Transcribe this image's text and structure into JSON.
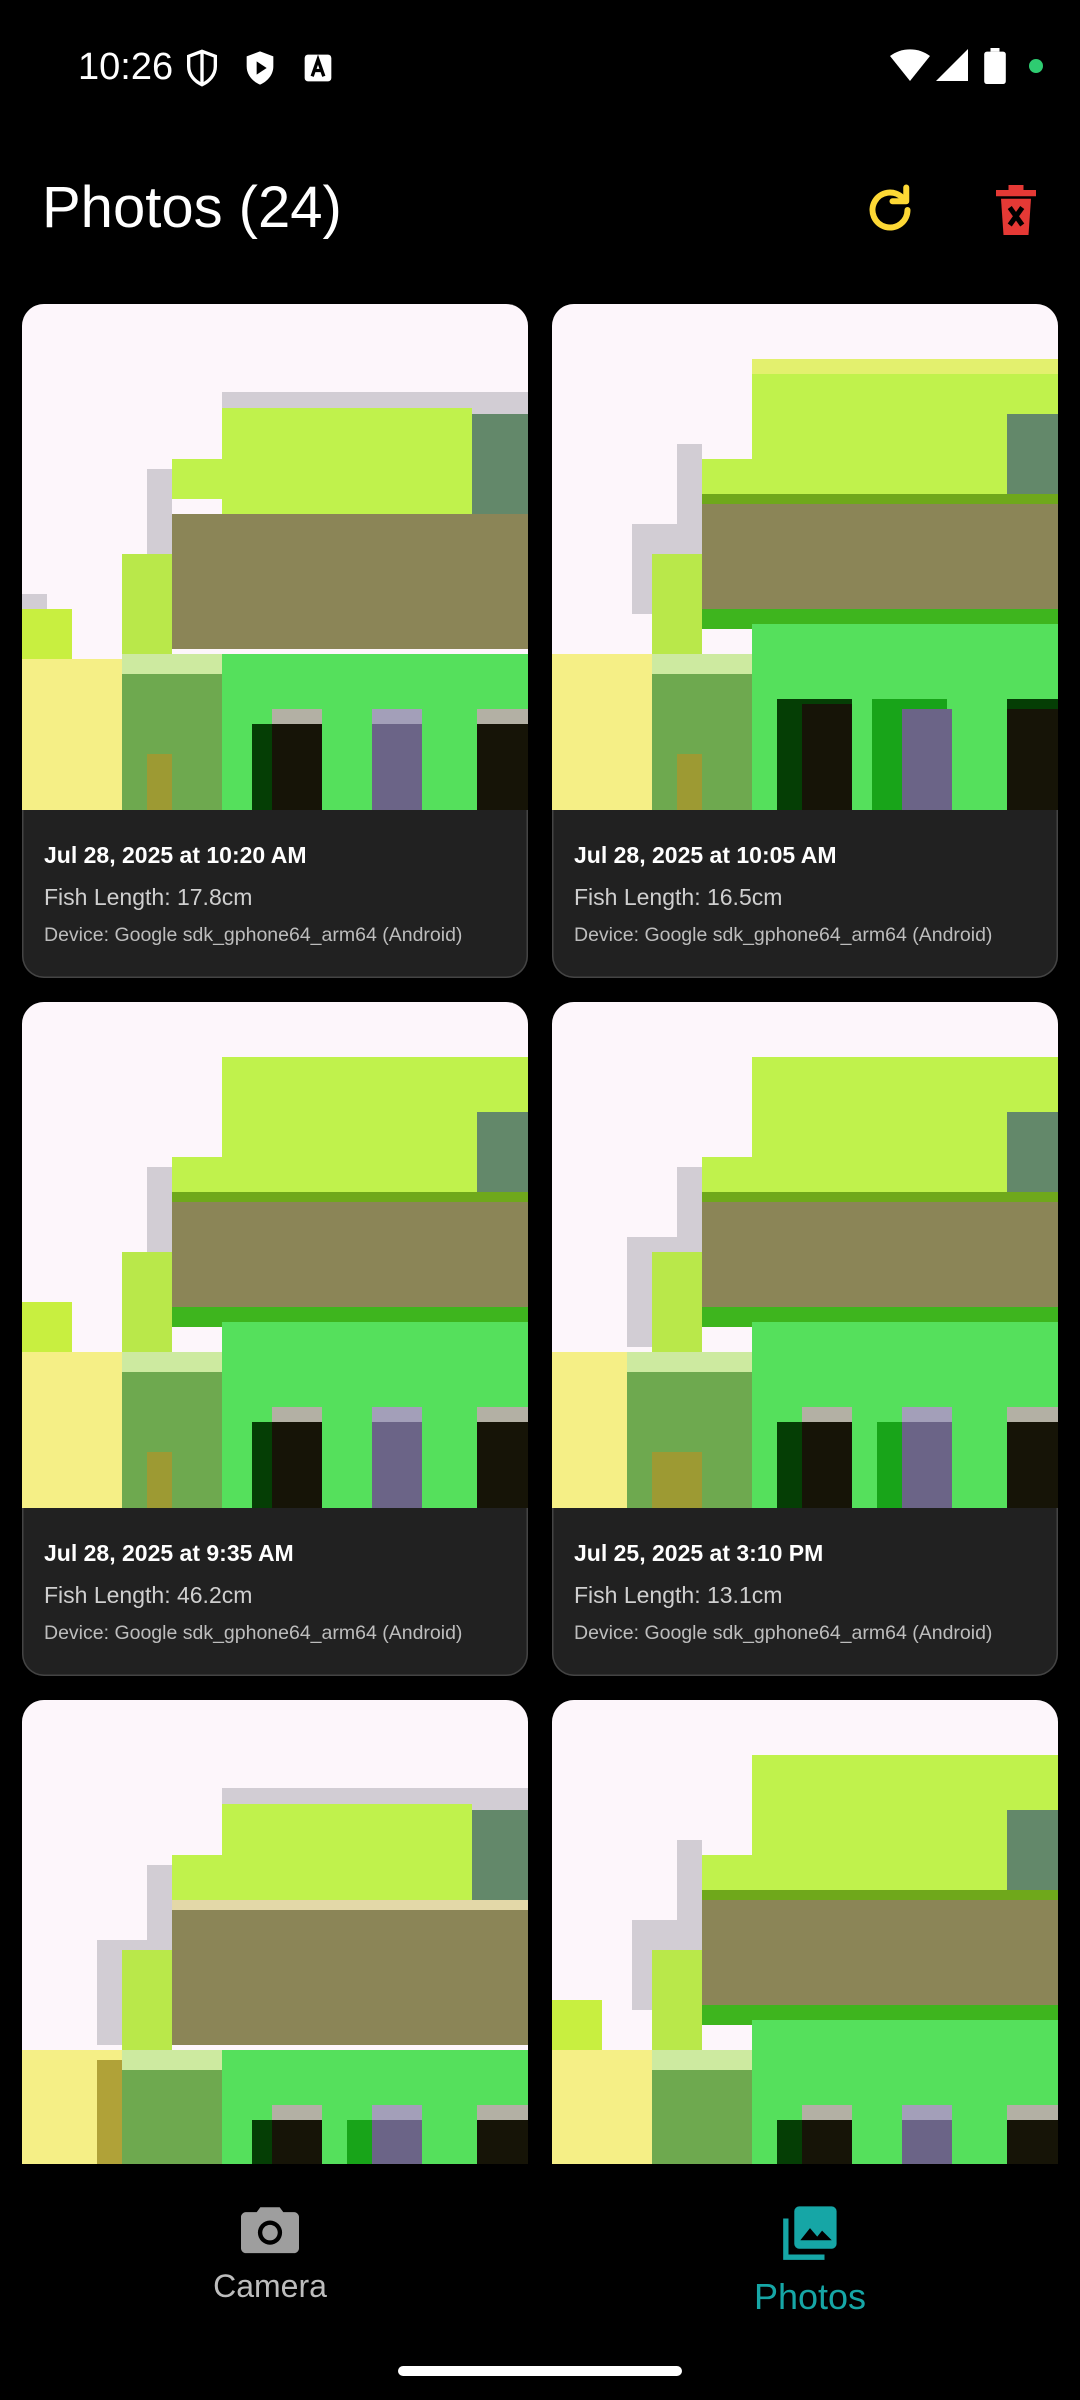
{
  "status_bar": {
    "time": "10:26",
    "icons": [
      "shield-icon",
      "play-store-icon",
      "text-a-icon",
      "wifi-icon",
      "signal-icon",
      "battery-icon",
      "dot-icon"
    ]
  },
  "app_bar": {
    "title": "Photos (24)",
    "refresh_icon": "refresh-icon",
    "delete_icon": "delete-icon",
    "colors": {
      "refresh": "#fdd835",
      "delete": "#e53935"
    }
  },
  "photos": [
    {
      "date": "Jul 28, 2025 at 10:20 AM",
      "length": "Fish Length: 17.8cm",
      "device": "Device: Google sdk_gphone64_arm64 (Android)"
    },
    {
      "date": "Jul 28, 2025 at 10:05 AM",
      "length": "Fish Length: 16.5cm",
      "device": "Device: Google sdk_gphone64_arm64 (Android)"
    },
    {
      "date": "Jul 28, 2025 at 9:35 AM",
      "length": "Fish Length: 46.2cm",
      "device": "Device: Google sdk_gphone64_arm64 (Android)"
    },
    {
      "date": "Jul 25, 2025 at 3:10 PM",
      "length": "Fish Length: 13.1cm",
      "device": "Device: Google sdk_gphone64_arm64 (Android)"
    },
    {
      "date": "",
      "length": "",
      "device": ""
    },
    {
      "date": "",
      "length": "",
      "device": ""
    }
  ],
  "bottom_nav": {
    "items": [
      {
        "label": "Camera",
        "icon": "camera-icon",
        "selected": false
      },
      {
        "label": "Photos",
        "icon": "photo-library-icon",
        "selected": true
      }
    ],
    "accent": "#16a6a6"
  }
}
